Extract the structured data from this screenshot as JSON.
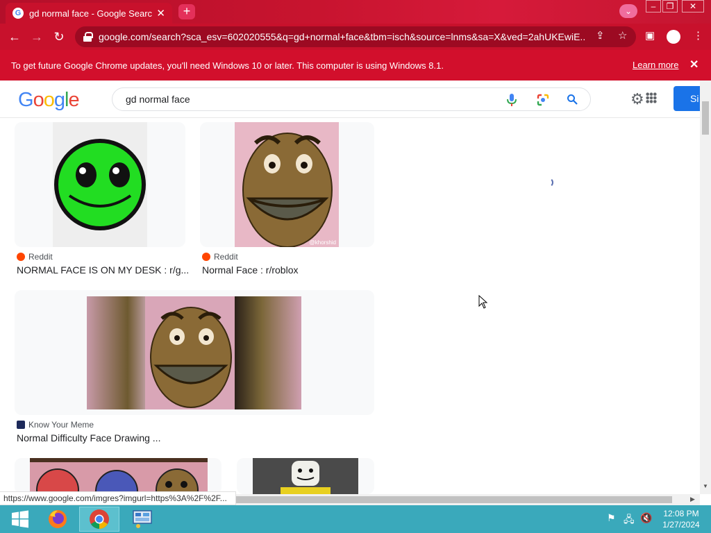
{
  "browser": {
    "tab_title": "gd normal face - Google Search",
    "url": "google.com/search?sca_esv=602020555&q=gd+normal+face&tbm=isch&source=lnms&sa=X&ved=2ahUKEwiE...",
    "tab_close": "✕",
    "new_tab": "+"
  },
  "infobar": {
    "message": "To get future Google Chrome updates, you'll need Windows 10 or later. This computer is using Windows 8.1.",
    "link": "Learn more"
  },
  "google": {
    "query": "gd normal face",
    "sign_in": "Si"
  },
  "results": [
    {
      "source": "Reddit",
      "title": "NORMAL FACE IS ON MY DESK : r/g..."
    },
    {
      "source": "Reddit",
      "title": "Normal Face : r/roblox"
    },
    {
      "source": "Know Your Meme",
      "title": "Normal Difficulty Face Drawing ..."
    }
  ],
  "image_watermark": "@khorshid",
  "status_url": "https://www.google.com/imgres?imgurl=https%3A%2F%2F...",
  "taskbar": {
    "time": "12:08 PM",
    "date": "1/27/2024"
  },
  "colors": {
    "chrome_red": "#c8112c",
    "infobar_red": "#d20f2c",
    "google_blue": "#1a73e8",
    "taskbar": "#3aa9bb"
  }
}
